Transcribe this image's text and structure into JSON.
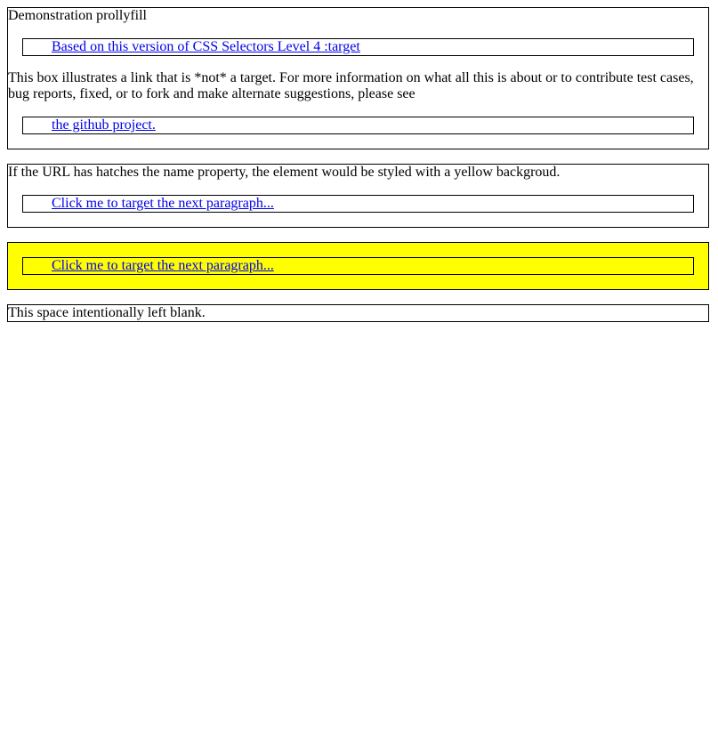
{
  "demo_box": {
    "title": "Demonstration prollyfill",
    "spec_link": "Based on this version of CSS Selectors Level 4 :target",
    "description": "This box illustrates a link that is *not* a target. For more information on what all this is about or to contribute test cases, bug reports, fixed, or to fork and make alternate suggestions, please see",
    "github_link": "the github project."
  },
  "url_box": {
    "text": "If the URL has hatches the name property, the element would be styled with a yellow backgroud.",
    "link": "Click me to target the next paragraph..."
  },
  "target_box": {
    "link": "Click me to target the next paragraph...",
    "background": "#ffff00"
  },
  "blank_box": {
    "text": "This space intentionally left blank."
  },
  "colors": {
    "link": "#0000ee",
    "highlight": "#ffff00"
  }
}
